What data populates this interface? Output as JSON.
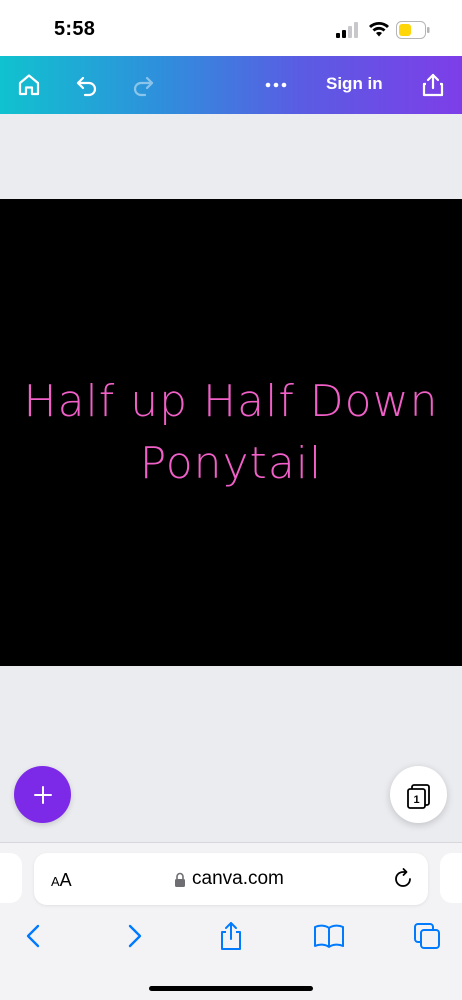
{
  "status_bar": {
    "time": "5:58",
    "signal_icon": "cellular-signal-icon",
    "wifi_icon": "wifi-icon",
    "battery_icon": "battery-low-icon",
    "battery_color": "#ffd60a"
  },
  "toolbar": {
    "home_icon": "home-icon",
    "undo_icon": "undo-icon",
    "redo_icon": "redo-icon",
    "more_icon": "more-icon",
    "sign_in_label": "Sign in",
    "share_icon": "share-icon",
    "gradient": [
      "#10c2cf",
      "#5a5ce3",
      "#7d3ee8"
    ]
  },
  "design": {
    "line1": "Half up Half Down",
    "line2": "Ponytail",
    "background": "#000000",
    "text_color": "#f15fc8"
  },
  "canvas_controls": {
    "add_icon": "plus-icon",
    "add_color": "#7d2ae8",
    "pages_icon": "pages-icon",
    "page_count": "1"
  },
  "safari": {
    "text_size_small": "A",
    "text_size_large": "A",
    "lock_icon": "lock-icon",
    "url": "canva.com",
    "reload_icon": "reload-icon",
    "back_icon": "back-icon",
    "forward_icon": "forward-icon",
    "share_icon": "share-icon",
    "bookmarks_icon": "bookmarks-icon",
    "tabs_icon": "tabs-icon",
    "accent": "#007aff"
  }
}
